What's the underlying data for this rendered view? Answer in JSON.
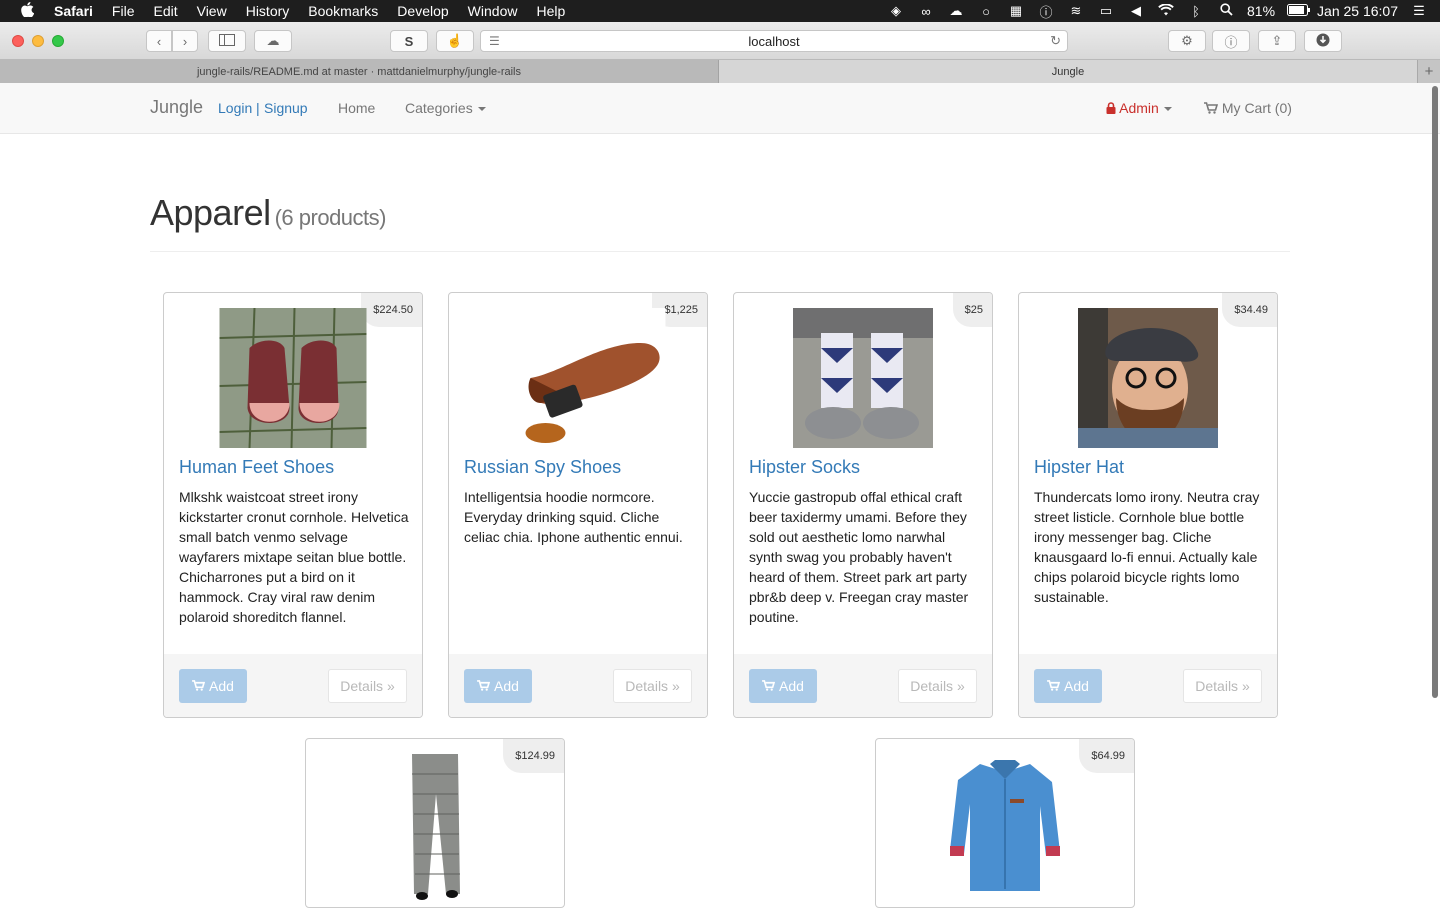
{
  "menubar": {
    "app": "Safari",
    "items": [
      "File",
      "Edit",
      "View",
      "History",
      "Bookmarks",
      "Develop",
      "Window",
      "Help"
    ],
    "battery": "81%",
    "datetime": "Jan 25  16:07"
  },
  "toolbar": {
    "url": "localhost",
    "extension_label": "S"
  },
  "tabs": {
    "inactive_title": "jungle-rails/README.md at master · mattdanielmurphy/jungle-rails",
    "active_title": "Jungle",
    "new_tab": "+"
  },
  "nav": {
    "brand": "Jungle",
    "login": "Login",
    "separator": "|",
    "signup": "Signup",
    "home": "Home",
    "categories": "Categories",
    "admin": "Admin",
    "cart": "My Cart (0)"
  },
  "page": {
    "title": "Apparel",
    "count": "(6 products)"
  },
  "products": [
    {
      "name": "Human Feet Shoes",
      "price": "$224.50",
      "description": "Mlkshk waistcoat street irony kickstarter cronut cornhole. Helvetica small batch venmo selvage wayfarers mixtape seitan blue bottle. Chicharrones put a bird on it hammock. Cray viral raw denim polaroid shoreditch flannel.",
      "add_label": "Add",
      "details_label": "Details »"
    },
    {
      "name": "Russian Spy Shoes",
      "price": "$1,225",
      "description": "Intelligentsia hoodie normcore. Everyday drinking squid. Cliche celiac chia. Iphone authentic ennui.",
      "add_label": "Add",
      "details_label": "Details »"
    },
    {
      "name": "Hipster Socks",
      "price": "$25",
      "description": "Yuccie gastropub offal ethical craft beer taxidermy umami. Before they sold out aesthetic lomo narwhal synth swag you probably haven't heard of them. Street park art party pbr&b deep v. Freegan cray master poutine.",
      "add_label": "Add",
      "details_label": "Details »"
    },
    {
      "name": "Hipster Hat",
      "price": "$34.49",
      "description": "Thundercats lomo irony. Neutra cray street listicle. Cornhole blue bottle irony messenger bag. Cliche knausgaard lo-fi ennui. Actually kale chips polaroid bicycle rights lomo sustainable.",
      "add_label": "Add",
      "details_label": "Details »"
    },
    {
      "price": "$124.99"
    },
    {
      "price": "$64.99"
    }
  ],
  "colors": {
    "link": "#337ab7",
    "admin": "#c9302c",
    "add_button": "#abcbe8"
  }
}
